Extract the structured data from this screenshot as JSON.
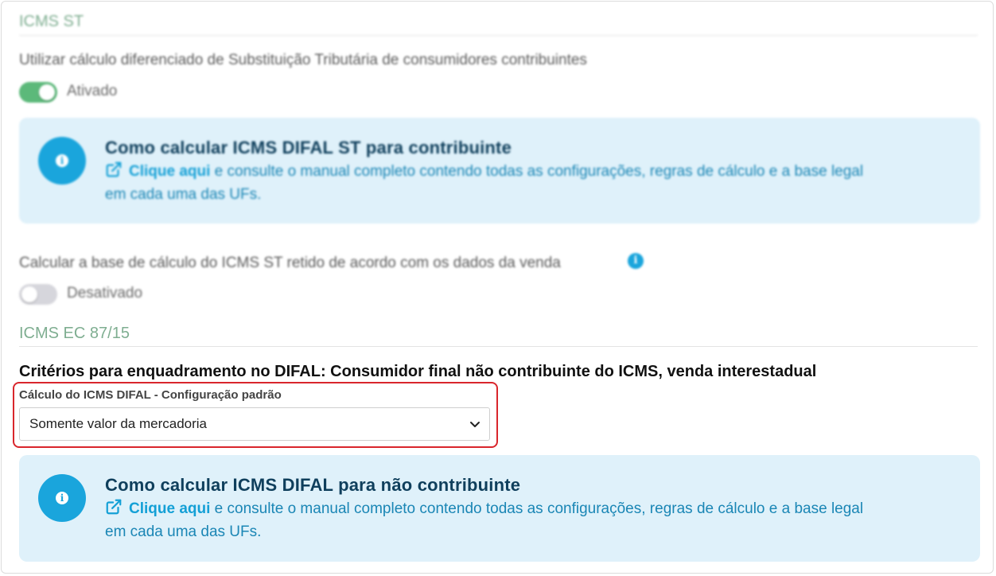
{
  "icms_st": {
    "title": "ICMS ST",
    "option1": {
      "label": "Utilizar cálculo diferenciado de Substituição Tributária de consumidores contribuintes",
      "state": "Ativado"
    },
    "info": {
      "title": "Como calcular ICMS DIFAL ST para contribuinte",
      "link": "Clique aqui",
      "text1": " e consulte o manual completo contendo todas as configurações, regras de cálculo e a base legal",
      "text2": "em cada uma das UFs."
    },
    "option2": {
      "label": "Calcular a base de cálculo do ICMS ST retido de acordo com os dados da venda",
      "state": "Desativado"
    }
  },
  "icms_ec": {
    "title": "ICMS EC 87/15",
    "criteria": "Critérios para enquadramento no DIFAL: Consumidor final não contribuinte do ICMS, venda interestadual",
    "field_label": "Cálculo do ICMS DIFAL - Configuração padrão",
    "select_value": "Somente valor da mercadoria",
    "info": {
      "title": "Como calcular ICMS DIFAL para não contribuinte",
      "link": "Clique aqui",
      "text1": " e consulte o manual completo contendo todas as configurações, regras de cálculo e a base legal",
      "text2": "em cada uma das UFs."
    }
  },
  "icons": {
    "info": "info-icon",
    "external_link": "external-link-icon",
    "chevron": "chevron-down-icon"
  },
  "colors": {
    "toggle_on": "#5cb97a",
    "info_bg": "#dff1fa",
    "info_accent": "#1aa5dc",
    "highlight": "#d9262c"
  }
}
